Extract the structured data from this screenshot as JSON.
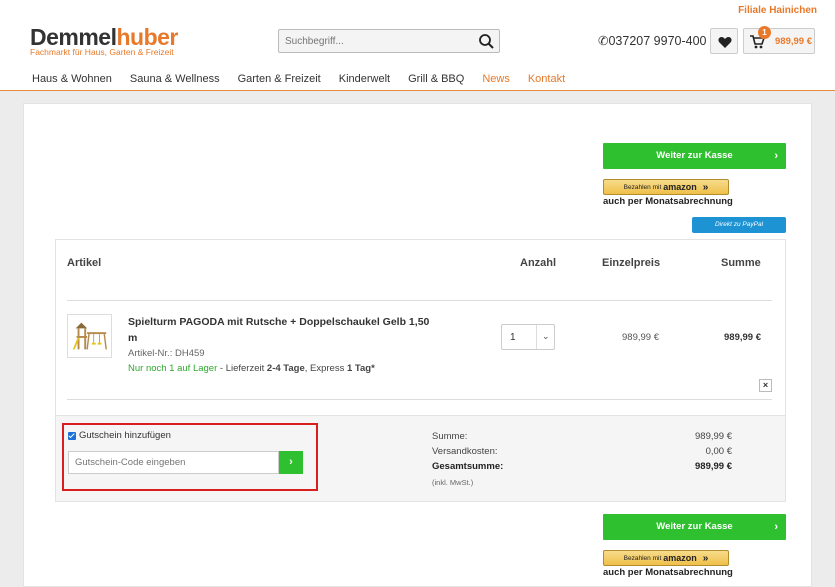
{
  "header": {
    "filiale": "Filiale Hainichen",
    "logo_part1": "Demmel",
    "logo_part2": "huber",
    "logo_sub": "Fachmarkt für Haus, Garten & Freizeit",
    "search_placeholder": "Suchbegriff...",
    "phone": "037207 9970-400",
    "cart_count": "1",
    "cart_amount": "989,99 €"
  },
  "nav": [
    {
      "label": "Haus & Wohnen"
    },
    {
      "label": "Sauna & Wellness"
    },
    {
      "label": "Garten & Freizeit"
    },
    {
      "label": "Kinderwelt"
    },
    {
      "label": "Grill & BBQ"
    },
    {
      "label": "News"
    },
    {
      "label": "Kontakt"
    }
  ],
  "checkout": {
    "button_label": "Weiter zur Kasse",
    "amazon_prefix": "Bezahlen mit",
    "amazon_brand": "amazon",
    "monats": "auch per Monatsabrechnung",
    "paypal": "Direkt zu PayPal"
  },
  "table": {
    "col_artikel": "Artikel",
    "col_anzahl": "Anzahl",
    "col_einzelpreis": "Einzelpreis",
    "col_summe": "Summe"
  },
  "item": {
    "name": "Spielturm PAGODA mit Rutsche + Doppelschaukel Gelb 1,50 m",
    "artnr": "Artikel-Nr.: DH459",
    "stock_green": "Nur noch 1 auf Lager",
    "stock_mid": " - Lieferzeit ",
    "stock_days": "2-4 Tage",
    "stock_express": ", Express ",
    "stock_express_days": "1 Tag*",
    "quantity": "1",
    "unit_price": "989,99 €",
    "total": "989,99 €",
    "remove": "×"
  },
  "voucher": {
    "checkbox_label": "Gutschein hinzufügen",
    "placeholder": "Gutschein-Code eingeben"
  },
  "totals": {
    "summe_label": "Summe:",
    "summe": "989,99 €",
    "versand_label": "Versandkosten:",
    "versand": "0,00 €",
    "gesamt_label": "Gesamtsumme:",
    "gesamt": "989,99 €",
    "mwst": "(inkl. MwSt.)"
  }
}
